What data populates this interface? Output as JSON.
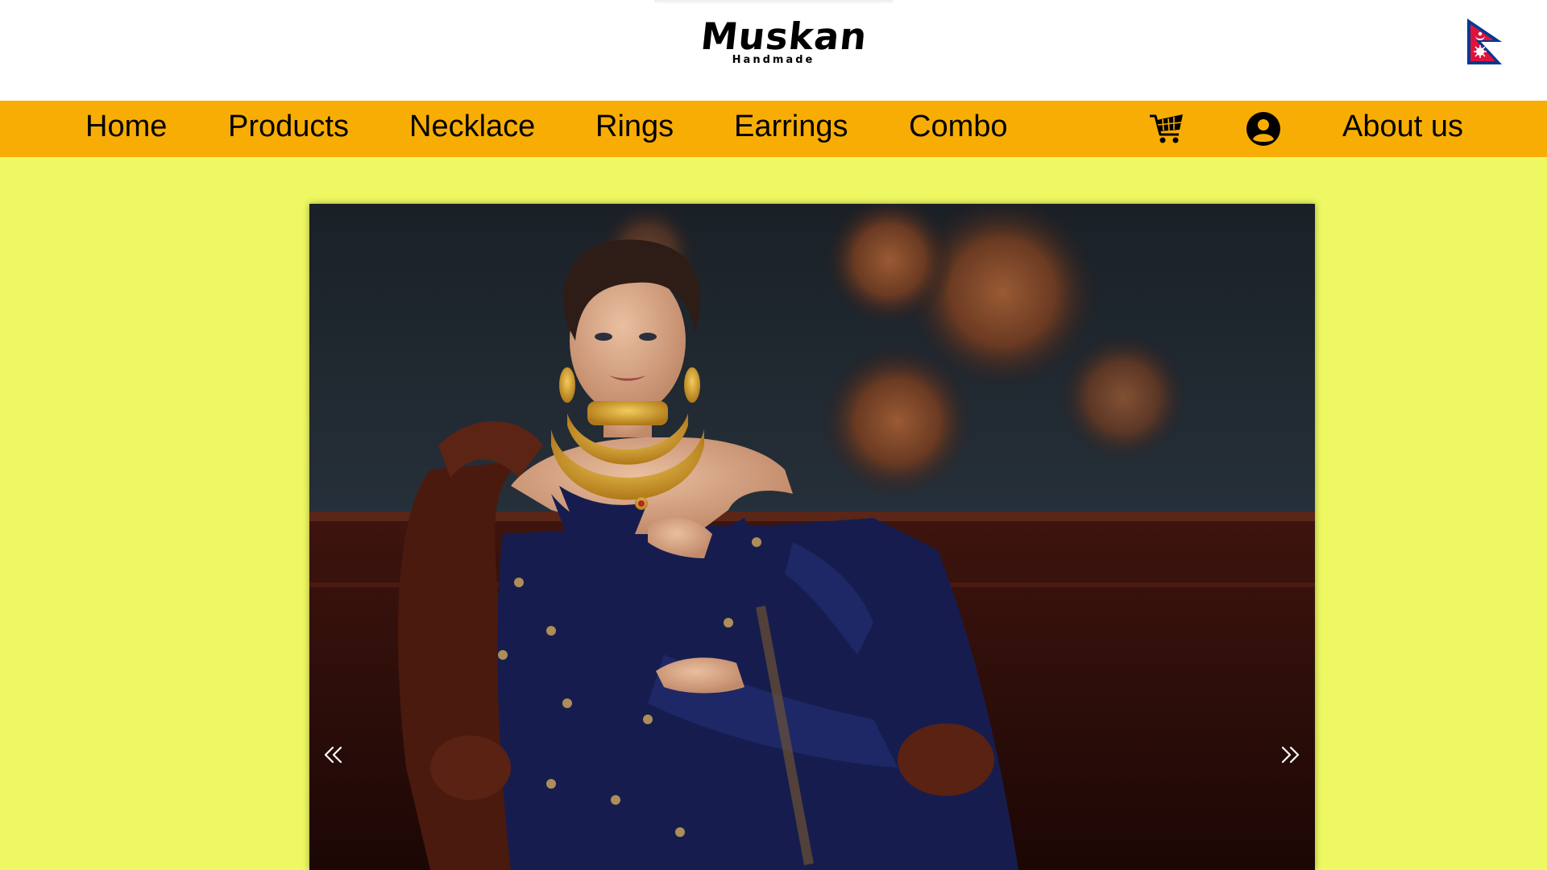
{
  "header": {
    "logo_title": "Muskan",
    "logo_subtitle": "Handmade",
    "flag_icon": "nepal-flag-icon"
  },
  "nav": {
    "items": [
      {
        "label": "Home"
      },
      {
        "label": "Products"
      },
      {
        "label": "Necklace"
      },
      {
        "label": "Rings"
      },
      {
        "label": "Earrings"
      },
      {
        "label": "Combo"
      }
    ],
    "cart_icon": "shopping-cart-icon",
    "account_icon": "user-account-icon",
    "about_label": "About us"
  },
  "slider": {
    "prev_icon": "double-chevron-left-icon",
    "next_icon": "double-chevron-right-icon",
    "slide_image": "model-in-navy-blue-dress-with-gold-jewelry"
  },
  "colors": {
    "page_background": "#eef862",
    "navbar_background": "#f8ad04",
    "header_background": "#ffffff",
    "flag_red": "#dc143c",
    "flag_blue": "#003893"
  }
}
